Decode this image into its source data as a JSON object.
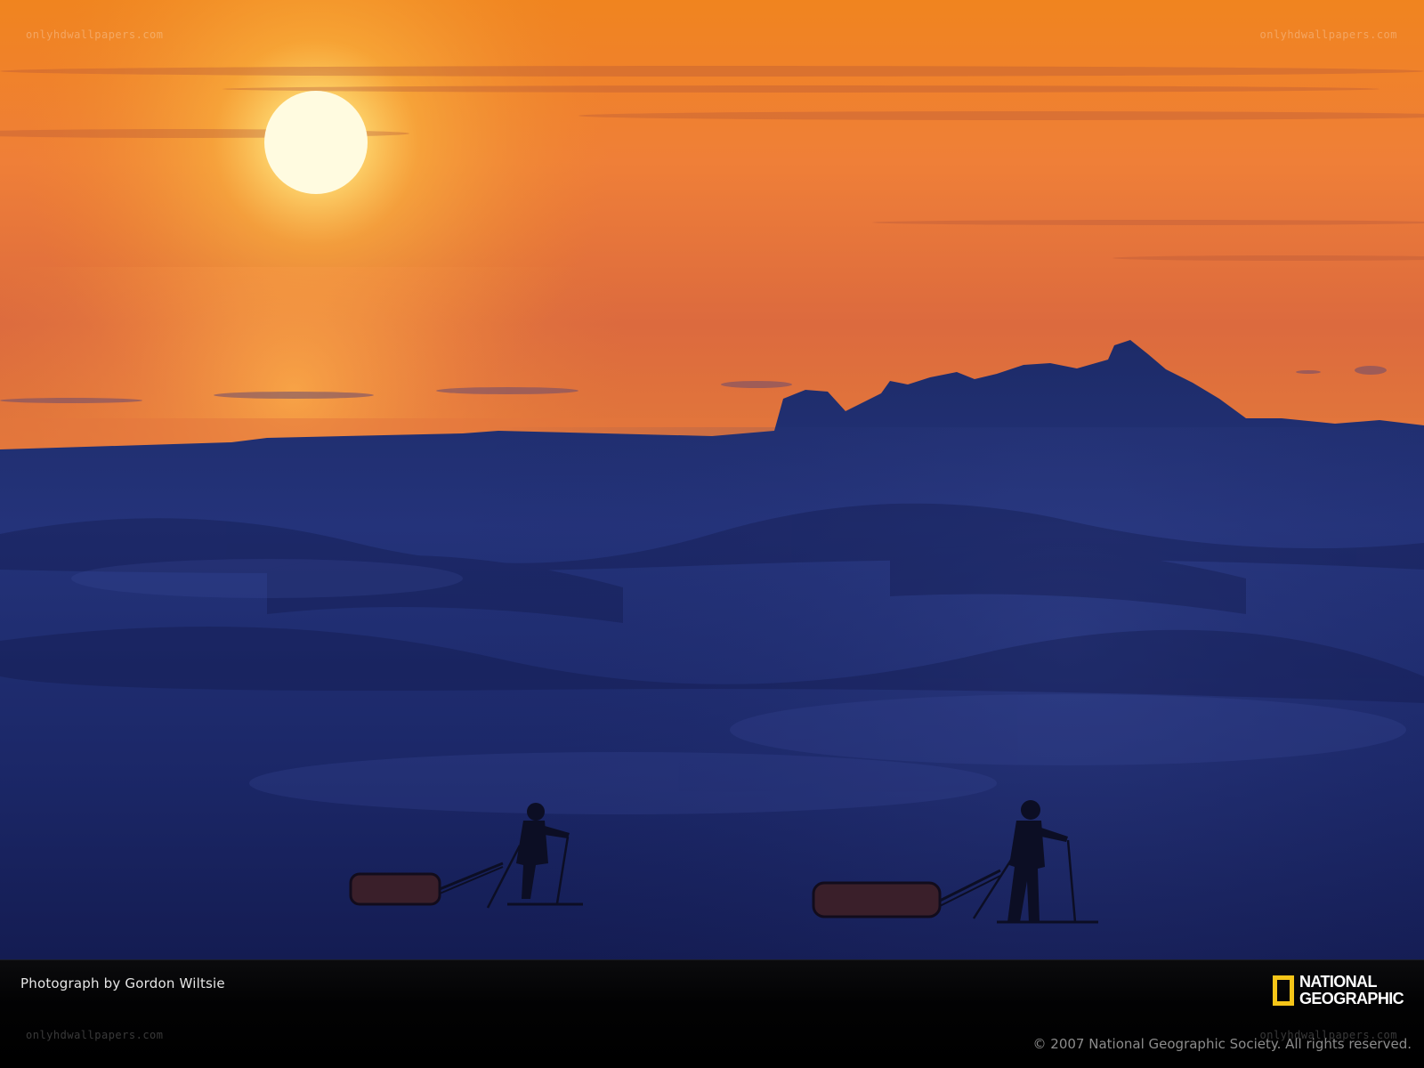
{
  "scene": {
    "subject": "arctic-sunset-skiers",
    "colors": {
      "sky_top": "#f07a22",
      "sky_mid": "#ef8a3a",
      "sky_low": "#d0623a",
      "horizon_glow": "#f6a640",
      "sun": "#fff6c8",
      "ice_far": "#1c2a66",
      "ice_near": "#141b52",
      "silhouette": "#0a0d22"
    }
  },
  "watermarks": {
    "top_left": "onlyhdwallpapers.com",
    "top_right": "onlyhdwallpapers.com",
    "bottom_left": "onlyhdwallpapers.com",
    "bottom_right": "onlyhdwallpapers.com"
  },
  "caption": {
    "credit": "Photograph by Gordon Wiltsie",
    "copyright": "© 2007 National Geographic Society. All rights reserved."
  },
  "logo": {
    "line1": "NATIONAL",
    "line2": "GEOGRAPHIC",
    "frame_color": "#f5c518"
  }
}
